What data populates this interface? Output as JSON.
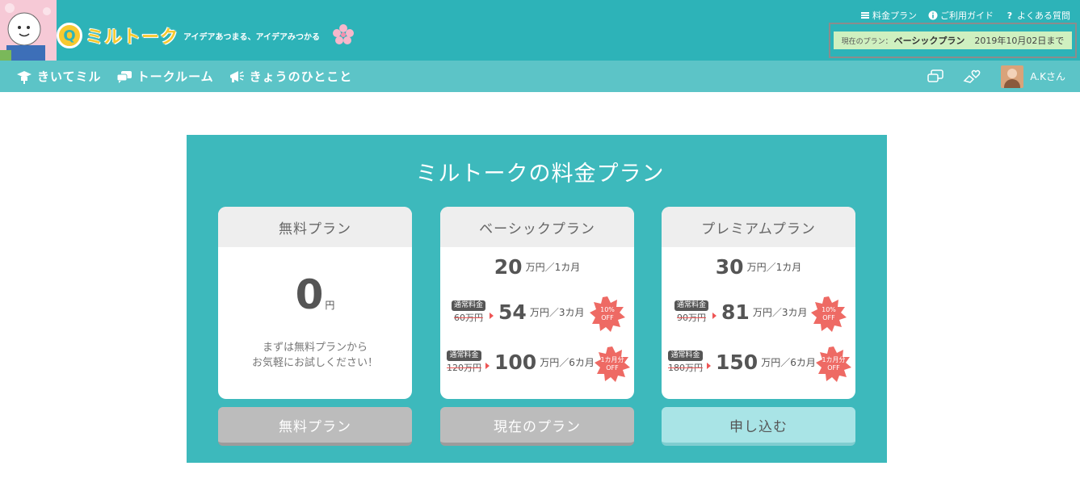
{
  "header": {
    "brand": "ミルトーク",
    "tagline": "アイデアあつまる、アイデアみつかる",
    "top_links": [
      {
        "label": "料金プラン",
        "icon": "price-icon"
      },
      {
        "label": "ご利用ガイド",
        "icon": "info-icon"
      },
      {
        "label": "よくある質問",
        "icon": "question-icon"
      }
    ],
    "current_plan": {
      "prefix": "現在のプラン：",
      "plan_name": "ベーシックプラン",
      "until": "2019年10月02日まで"
    }
  },
  "nav": {
    "items": [
      {
        "label": "きいてミル",
        "icon": "mortarboard-icon"
      },
      {
        "label": "トークルーム",
        "icon": "chat-bubbles-icon"
      },
      {
        "label": "きょうのひとこと",
        "icon": "megaphone-icon"
      }
    ],
    "user_name": "A.Kさん"
  },
  "pricing": {
    "title": "ミルトークの料金プラン",
    "plans": [
      {
        "name": "無料プラン",
        "price": "0",
        "price_unit": "円",
        "note_line1": "まずは無料プランから",
        "note_line2": "お気軽にお試しください！",
        "button": "無料プラン"
      },
      {
        "name": "ベーシックプラン",
        "monthly": "20",
        "monthly_unit": "万円／1カ月",
        "regular_badge": "通常料金",
        "three_month_orig": "60万円",
        "three_month": "54",
        "three_month_unit": "万円／3カ月",
        "three_month_burst_1": "10%",
        "three_month_burst_2": "OFF",
        "six_month_orig": "120万円",
        "six_month": "100",
        "six_month_unit": "万円／6カ月",
        "six_month_burst_1": "1カ月分",
        "six_month_burst_2": "OFF",
        "button": "現在のプラン"
      },
      {
        "name": "プレミアムプラン",
        "monthly": "30",
        "monthly_unit": "万円／1カ月",
        "regular_badge": "通常料金",
        "three_month_orig": "90万円",
        "three_month": "81",
        "three_month_unit": "万円／3カ月",
        "three_month_burst_1": "10%",
        "three_month_burst_2": "OFF",
        "six_month_orig": "180万円",
        "six_month": "150",
        "six_month_unit": "万円／6カ月",
        "six_month_burst_1": "1カ月分",
        "six_month_burst_2": "OFF",
        "button": "申し込む"
      }
    ]
  },
  "colors": {
    "header_teal": "#2db3b8",
    "nav_teal": "#5cc4c7",
    "panel_teal": "#3db9bc",
    "discount_red": "#ee6a64",
    "apply_button": "#a9e4e6",
    "disabled_button": "#bcbcbc",
    "plan_badge_bg": "#cff0c0"
  }
}
